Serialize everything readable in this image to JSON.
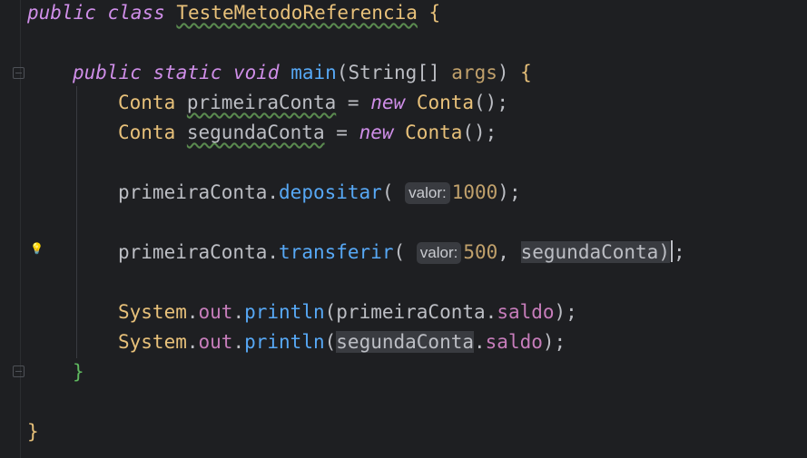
{
  "code": {
    "line1": {
      "kw": "public class",
      "class_name": "TesteMetodoReferencia",
      "brace": "{"
    },
    "line2": {
      "kw": "public static void",
      "method": "main",
      "open": "(",
      "type": "String[]",
      "param": "args",
      "close": ")",
      "brace": "{"
    },
    "line3": {
      "type": "Conta",
      "var": "primeiraConta",
      "eq": "=",
      "kw": "new",
      "ctor": "Conta",
      "tail": "();"
    },
    "line4": {
      "type": "Conta",
      "var": "segundaConta",
      "eq": "=",
      "kw": "new",
      "ctor": "Conta",
      "tail": "();"
    },
    "line5": {
      "obj": "primeiraConta",
      "dot": ".",
      "method": "depositar",
      "open": "(",
      "hint": "valor:",
      "arg": "1000",
      "close": ");"
    },
    "line6": {
      "obj": "primeiraConta",
      "dot": ".",
      "method": "transferir",
      "open": "(",
      "hint": "valor:",
      "arg1": "500",
      "comma": ",",
      "arg2": "segundaConta",
      "close": ")",
      "semi": ";"
    },
    "line7": {
      "cls": "System",
      "field": "out",
      "method": "println",
      "open": "(",
      "obj": "primeiraConta",
      "fld": "saldo",
      "close": ");"
    },
    "line8": {
      "cls": "System",
      "field": "out",
      "method": "println",
      "open": "(",
      "obj": "segundaConta",
      "fld": "saldo",
      "close": ");"
    },
    "line9": {
      "brace": "}"
    },
    "line10": {
      "brace": "}"
    }
  },
  "colors": {
    "background": "#1e1f22",
    "keyword": "#cf8ee8",
    "class": "#e8c17a",
    "method": "#57a8f5",
    "field": "#c77dbb",
    "number": "#2aacb8"
  },
  "icons": {
    "bulb": "lightbulb-icon"
  }
}
